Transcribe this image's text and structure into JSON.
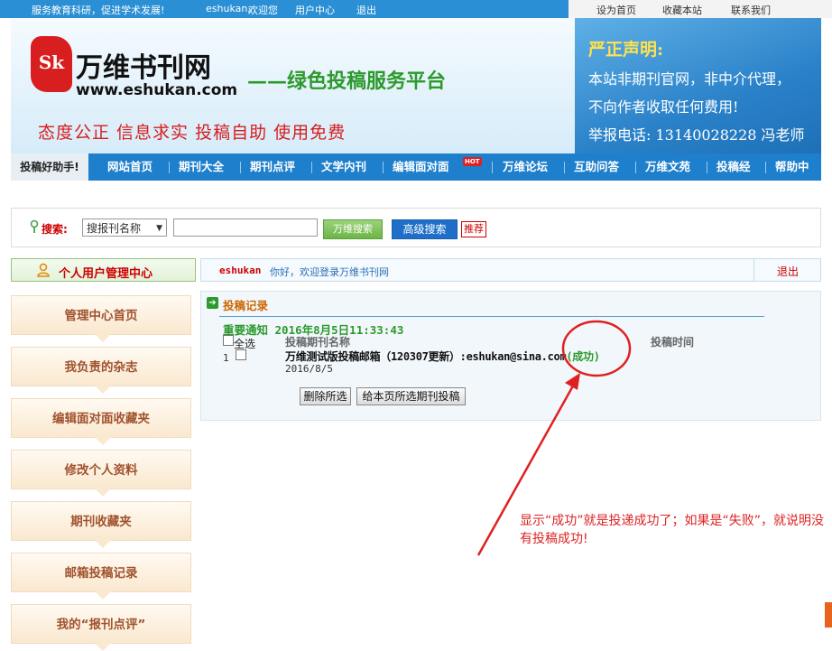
{
  "topbar": {
    "tagline": "服务教育科研，促进学术发展!",
    "username": "eshukan,",
    "welcome": "欢迎您",
    "user_center": "用户中心",
    "logout": "退出",
    "set_home": "设为首页",
    "bookmark": "收藏本站",
    "contact": "联系我们"
  },
  "banner": {
    "seal_text": "Sk",
    "site_name": "万维书刊网",
    "site_url": "www.eshukan.com",
    "slogan_main": "——绿色投稿服务平台",
    "slogan_sub": "态度公正  信息求实  投稿自助  使用免费",
    "declaration_title": "严正声明:",
    "declaration_lines": [
      "本站非期刊官网，非中介代理，",
      "不向作者收取任何费用!",
      "举报电话: 13140028228 冯老师"
    ]
  },
  "nav": {
    "helper": "投稿好助手!",
    "items": [
      "网站首页",
      "期刊大全",
      "期刊点评",
      "文学内刊",
      "编辑面对面",
      "万维论坛",
      "互助问答",
      "万维文苑",
      "投稿经",
      "帮助中"
    ],
    "hot_badge": "HOT"
  },
  "search": {
    "label": "搜索:",
    "select_value": "搜报刊名称",
    "input_value": "",
    "search_button": "万维搜索",
    "advanced_button": "高级搜索",
    "recommend": "推荐"
  },
  "sidebar": {
    "title": "个人用户管理中心",
    "items": [
      "管理中心首页",
      "我负责的杂志",
      "编辑面对面收藏夹",
      "修改个人资料",
      "期刊收藏夹",
      "邮箱投稿记录",
      "我的“报刊点评”"
    ]
  },
  "welcome_bar": {
    "username": "eshukan",
    "message": "你好，欢迎登录万维书刊网",
    "logout": "退出"
  },
  "records": {
    "title": "投稿记录",
    "notice": "重要通知 2016年8月5日11:33:43",
    "select_all": "全选",
    "col_journal": "投稿期刊名称",
    "col_time": "投稿时间",
    "rows": [
      {
        "index": "1",
        "title": "万维测试版投稿邮箱（120307更新）:eshukan@sina.com",
        "status": "(成功)",
        "date": "2016/8/5"
      }
    ],
    "delete_button": "删除所选",
    "send_button": "给本页所选期刊投稿"
  },
  "annotation": {
    "text": "显示“成功”就是投递成功了；如果是“失败”，就说明没有投稿成功!",
    "color": "#dd2222"
  }
}
